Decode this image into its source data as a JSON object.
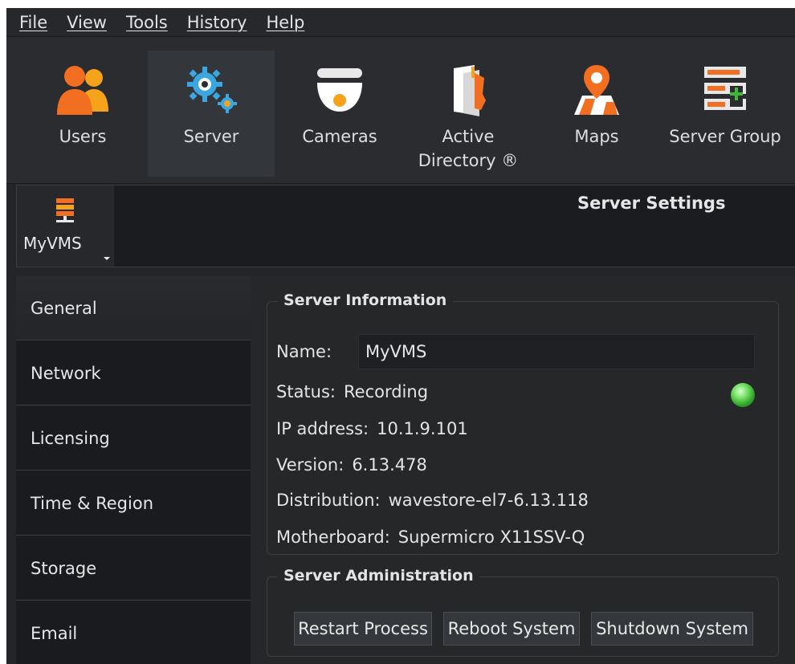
{
  "menu": [
    "File",
    "View",
    "Tools",
    "History",
    "Help"
  ],
  "toolbar": {
    "users": "Users",
    "server": "Server",
    "cameras": "Cameras",
    "active_directory_line1": "Active",
    "active_directory_line2": "Directory ®",
    "maps": "Maps",
    "server_group": "Server Group"
  },
  "server_selector": {
    "name": "MyVMS"
  },
  "header": {
    "title": "Server Settings"
  },
  "sidebar": {
    "items": [
      {
        "label": "General",
        "active": true
      },
      {
        "label": "Network"
      },
      {
        "label": "Licensing"
      },
      {
        "label": "Time & Region"
      },
      {
        "label": "Storage"
      },
      {
        "label": "Email"
      }
    ]
  },
  "server_info": {
    "title": "Server Information",
    "name_label": "Name:",
    "name_value": "MyVMS",
    "status_label": "Status:",
    "status_value": "Recording",
    "ip_label": "IP address:",
    "ip_value": "10.1.9.101",
    "version_label": "Version:",
    "version_value": "6.13.478",
    "distribution_label": "Distribution:",
    "distribution_value": "wavestore-el7-6.13.118",
    "motherboard_label": "Motherboard:",
    "motherboard_value": "Supermicro X11SSV-Q",
    "status_color": "#3fb83a"
  },
  "server_admin": {
    "title": "Server Administration",
    "restart": "Restart Process",
    "reboot": "Reboot System",
    "shutdown": "Shutdown System"
  },
  "colors": {
    "accent_orange": "#f26f21",
    "background": "#232528"
  }
}
